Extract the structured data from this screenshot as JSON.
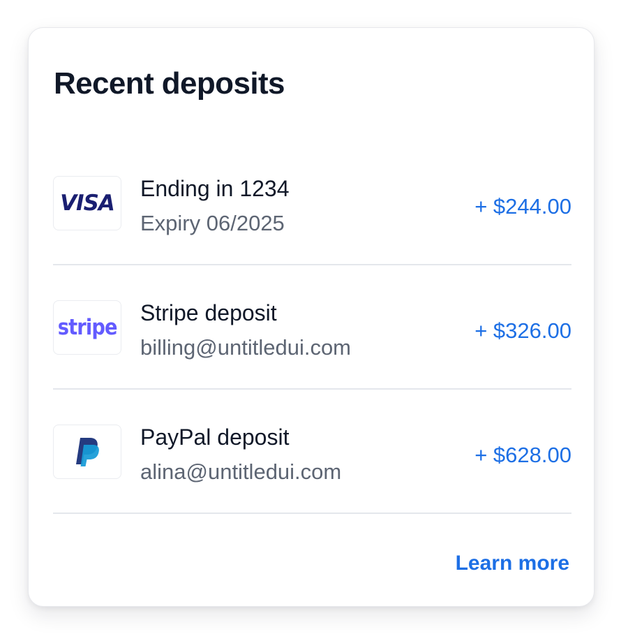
{
  "card": {
    "title": "Recent deposits",
    "learn_more_label": "Learn more"
  },
  "deposits": [
    {
      "logo": "visa-logo",
      "logo_text": "VISA",
      "title": "Ending in 1234",
      "subtitle": "Expiry 06/2025",
      "amount": "+ $244.00"
    },
    {
      "logo": "stripe-logo",
      "logo_text": "stripe",
      "title": "Stripe deposit",
      "subtitle": "billing@untitledui.com",
      "amount": "+ $326.00"
    },
    {
      "logo": "paypal-logo",
      "title": "PayPal deposit",
      "subtitle": "alina@untitledui.com",
      "amount": "+ $628.00"
    }
  ],
  "colors": {
    "accent": "#1d6fe5",
    "title_text": "#101828",
    "secondary_text": "#5d6573",
    "divider": "#e4e7ec",
    "visa_blue": "#1a1f71",
    "stripe_purple": "#635bff",
    "paypal_dark": "#253b80",
    "paypal_light": "#179bd7"
  }
}
